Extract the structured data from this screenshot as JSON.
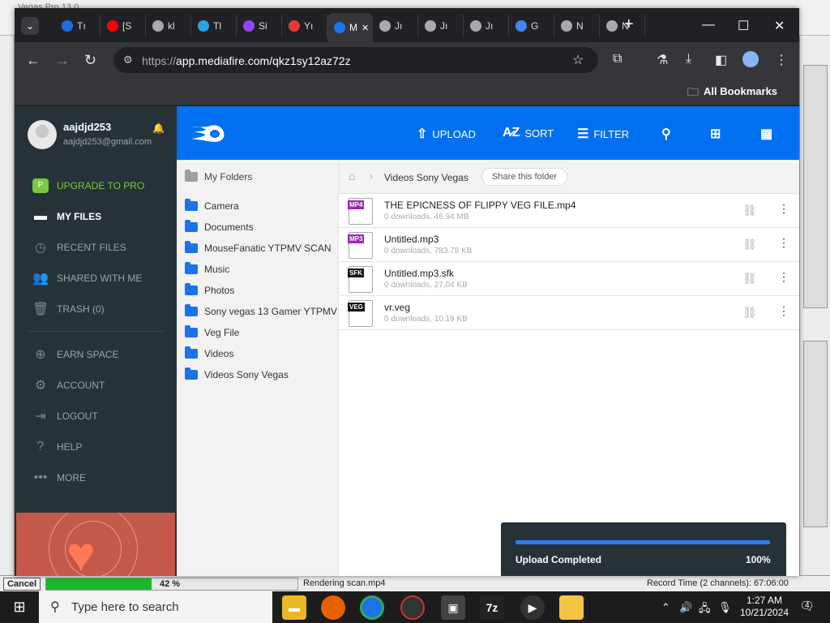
{
  "background_app": {
    "title_fragment": "Vegas Pro 13.0",
    "status": {
      "cancel_label": "Cancel",
      "progress": 0.42,
      "progress_label": "42 %",
      "rendering_text": "Rendering scan.mp4",
      "record_time": "Record Time (2 channels): 67:06:00"
    }
  },
  "browser": {
    "tabs": [
      {
        "label": "Tı",
        "icon": "edge-icon",
        "color": "#1f6fe0"
      },
      {
        "label": "[S",
        "icon": "youtube-icon",
        "color": "#ff0000"
      },
      {
        "label": "kl",
        "icon": "globe-icon",
        "color": "#aaaaaa"
      },
      {
        "label": "Tl",
        "icon": "telegram-icon",
        "color": "#2aa3e0"
      },
      {
        "label": "Si",
        "icon": "twitch-icon",
        "color": "#9146ff"
      },
      {
        "label": "Yı",
        "icon": "download-icon",
        "color": "#e53935"
      },
      {
        "label": "M",
        "icon": "mediafire-icon",
        "color": "#1a73e8",
        "active": true
      },
      {
        "label": "Jı",
        "icon": "globe-icon",
        "color": "#aaaaaa"
      },
      {
        "label": "Jı",
        "icon": "globe-icon",
        "color": "#aaaaaa"
      },
      {
        "label": "Jı",
        "icon": "globe-icon",
        "color": "#aaaaaa"
      },
      {
        "label": "G",
        "icon": "google-icon",
        "color": "#4285f4"
      },
      {
        "label": "N",
        "icon": "globe-icon",
        "color": "#aaaaaa"
      },
      {
        "label": "N",
        "icon": "globe-icon",
        "color": "#aaaaaa"
      }
    ],
    "new_tab_glyph": "+",
    "url_prefix": "https://",
    "url_rest": "app.mediafire.com/qkz1sy12az72z",
    "bookmarks_label": "All Bookmarks"
  },
  "mediafire": {
    "user": {
      "name": "aajdjd253",
      "email": "aajdjd253@gmail.com"
    },
    "nav": [
      {
        "label": "UPGRADE TO PRO",
        "icon": "pro-icon",
        "glyph": "P"
      },
      {
        "label": "MY FILES",
        "icon": "folder-icon",
        "glyph": "▬"
      },
      {
        "label": "RECENT FILES",
        "icon": "clock-icon",
        "glyph": "◷"
      },
      {
        "label": "SHARED WITH ME",
        "icon": "people-icon",
        "glyph": "👥"
      },
      {
        "label": "TRASH (0)",
        "icon": "trash-icon",
        "glyph": "🗑"
      },
      {
        "label": "EARN SPACE",
        "icon": "plus-circle-icon",
        "glyph": "⊕"
      },
      {
        "label": "ACCOUNT",
        "icon": "gear-icon",
        "glyph": "⚙"
      },
      {
        "label": "LOGOUT",
        "icon": "logout-icon",
        "glyph": "⇥"
      },
      {
        "label": "HELP",
        "icon": "help-icon",
        "glyph": "?"
      },
      {
        "label": "MORE",
        "icon": "more-icon",
        "glyph": "•••"
      }
    ],
    "toolbar": {
      "upload": "UPLOAD",
      "sort": "SORT",
      "filter": "FILTER"
    },
    "my_folders": "My Folders",
    "folders": [
      "Camera",
      "Documents",
      "MouseFanatic YTPMV SCAN",
      "Music",
      "Photos",
      "Sony vegas 13 Gamer YTPMV",
      "Veg File",
      "Videos",
      "Videos Sony Vegas"
    ],
    "breadcrumb": {
      "current": "Videos Sony Vegas",
      "share_label": "Share this folder"
    },
    "files": [
      {
        "tag": "MP4",
        "tag_color": "#9c27b0",
        "name": "THE EPICNESS OF FLIPPY VEG FILE.mp4",
        "meta": "0 downloads, 46.94 MB"
      },
      {
        "tag": "MP3",
        "tag_color": "#9c27b0",
        "name": "Untitled.mp3",
        "meta": "0 downloads, 783.78 KB"
      },
      {
        "tag": "SFK",
        "tag_color": "#111111",
        "name": "Untitled.mp3.sfk",
        "meta": "0 downloads, 27.04 KB"
      },
      {
        "tag": "VEG",
        "tag_color": "#111111",
        "name": "vr.veg",
        "meta": "0 downloads, 10.19 KB"
      }
    ],
    "upload_status": {
      "label": "Upload Completed",
      "percent": "100%",
      "progress": 1.0
    }
  },
  "taskbar": {
    "search_placeholder": "Type here to search",
    "time": "1:27 AM",
    "date": "10/21/2024",
    "notification_count": "4"
  },
  "colors": {
    "accent": "#0070f0",
    "sidebar": "#263238",
    "pro_green": "#7ac943"
  }
}
